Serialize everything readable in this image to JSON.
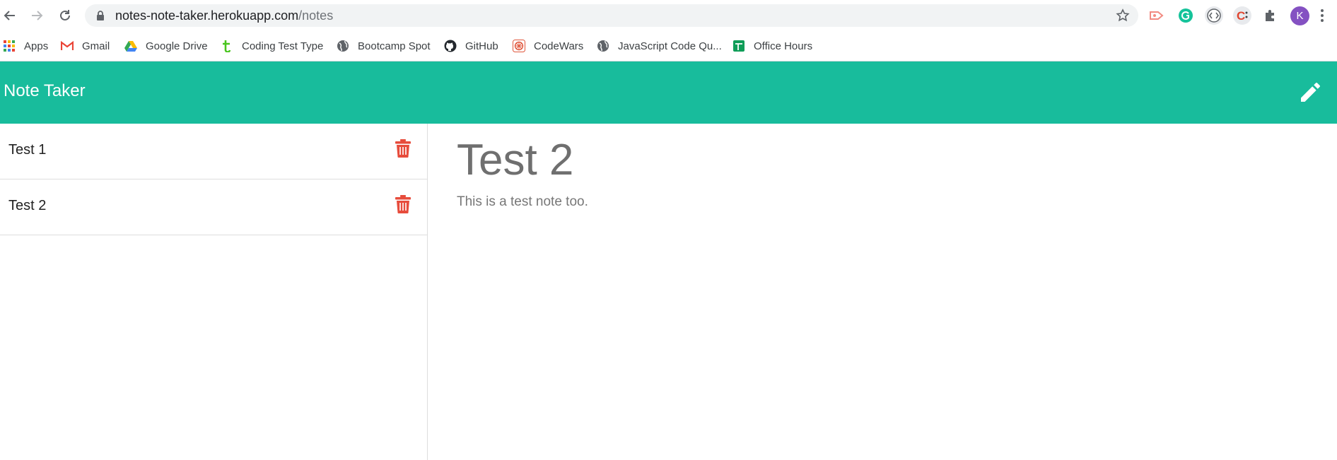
{
  "browser": {
    "url_host": "notes-note-taker.herokuapp.com",
    "url_path": "/notes",
    "profile_initial": "K",
    "bookmarks": [
      {
        "label": "Apps",
        "icon": "apps-grid-icon"
      },
      {
        "label": "Gmail",
        "icon": "gmail-icon"
      },
      {
        "label": "Google Drive",
        "icon": "google-drive-icon"
      },
      {
        "label": "Coding Test Type",
        "icon": "coding-test-type-icon"
      },
      {
        "label": "Bootcamp Spot",
        "icon": "globe-icon"
      },
      {
        "label": "GitHub",
        "icon": "github-icon"
      },
      {
        "label": "CodeWars",
        "icon": "codewars-icon"
      },
      {
        "label": "JavaScript Code Qu...",
        "icon": "globe-icon"
      },
      {
        "label": "Office Hours",
        "icon": "sheets-icon"
      }
    ],
    "extensions": [
      "screencast-icon",
      "grammarly-icon",
      "code-brackets-icon",
      "c-extension-icon",
      "puzzle-icon"
    ]
  },
  "app": {
    "brand": "Note Taker",
    "colors": {
      "accent": "#18bc9c",
      "delete": "#e74c3c"
    },
    "notes": [
      {
        "title": "Test 1"
      },
      {
        "title": "Test 2"
      }
    ],
    "active_note": {
      "title": "Test 2",
      "text": "This is a test note too."
    }
  }
}
